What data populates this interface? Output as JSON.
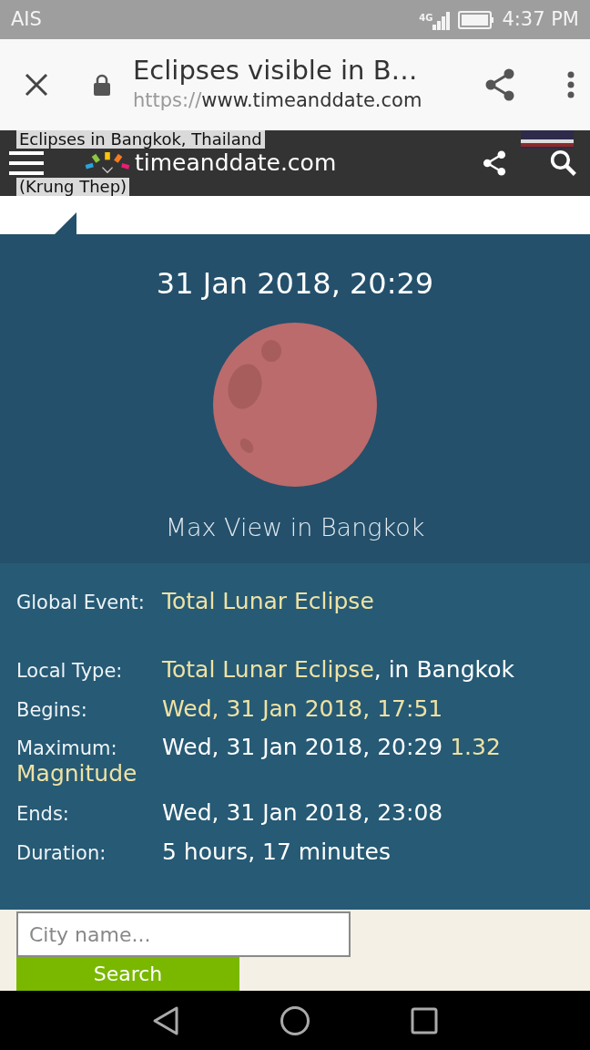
{
  "status_bar": {
    "carrier": "AIS",
    "network": "4G",
    "time": "4:37 PM"
  },
  "browser_bar": {
    "page_title": "Eclipses visible in B…",
    "url_scheme": "https://",
    "url_host": "www.timeanddate.com"
  },
  "site_header": {
    "logo_text": "timeanddate.com"
  },
  "page_title_lines": [
    "Eclipses in Bangkok, Thailand",
    "(Krung Thep)"
  ],
  "eclipse_view": {
    "datetime": "31 Jan 2018, 20:29",
    "caption": "Max View in Bangkok"
  },
  "detail_groups": [
    {
      "rows": [
        {
          "label": "Global Event:",
          "value": [
            {
              "text": "Total Lunar Eclipse",
              "highlight": true
            }
          ]
        }
      ]
    },
    {
      "rows": [
        {
          "label": "Local Type:",
          "value": [
            {
              "text": "Total Lunar Eclipse",
              "highlight": true
            },
            {
              "text": ", in Bangkok",
              "highlight": false
            }
          ]
        },
        {
          "label": "Begins:",
          "value": [
            {
              "text": "Wed, 31 Jan 2018, 17:51",
              "highlight": true
            }
          ]
        },
        {
          "label": "Maximum:",
          "value": [
            {
              "text": "Wed, 31 Jan 2018, 20:29 ",
              "highlight": false
            },
            {
              "text": "1.32 Magnitude",
              "highlight": true
            }
          ]
        },
        {
          "label": "Ends:",
          "value": [
            {
              "text": "Wed, 31 Jan 2018, 23:08",
              "highlight": false
            }
          ]
        },
        {
          "label": "Duration:",
          "value": [
            {
              "text": "5 hours, 17 minutes",
              "highlight": false
            }
          ]
        }
      ]
    }
  ],
  "city_search": {
    "placeholder": "City name...",
    "button": "Search"
  }
}
